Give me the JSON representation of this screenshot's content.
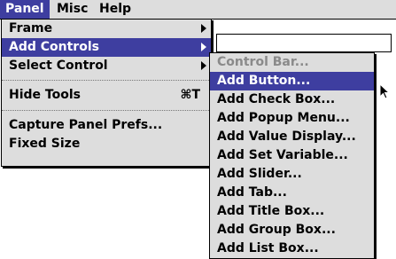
{
  "menubar": {
    "items": [
      {
        "label": "Panel"
      },
      {
        "label": "Misc"
      },
      {
        "label": "Help"
      }
    ]
  },
  "panel_menu": {
    "items": [
      {
        "label": "Frame",
        "submenu": true
      },
      {
        "label": "Add Controls",
        "submenu": true,
        "highlighted": true
      },
      {
        "label": "Select Control",
        "submenu": true
      },
      {
        "label": "Hide Tools",
        "shortcut": "⌘T"
      },
      {
        "label": "Capture Panel Prefs..."
      },
      {
        "label": "Fixed Size"
      }
    ]
  },
  "add_controls_submenu": {
    "items": [
      {
        "label": "Control Bar...",
        "disabled": true
      },
      {
        "label": "Add Button...",
        "highlighted": true
      },
      {
        "label": "Add Check Box..."
      },
      {
        "label": "Add Popup Menu..."
      },
      {
        "label": "Add Value Display..."
      },
      {
        "label": "Add Set Variable..."
      },
      {
        "label": "Add Slider..."
      },
      {
        "label": "Add Tab..."
      },
      {
        "label": "Add Title Box..."
      },
      {
        "label": "Add Group Box..."
      },
      {
        "label": "Add List Box..."
      }
    ]
  },
  "colors": {
    "highlight": "#3e3ea0",
    "menu_bg": "#dddddd",
    "disabled": "#8a8a8a"
  },
  "icons": {
    "submenu_arrow": "triangle-right",
    "cursor": "arrow-pointer"
  }
}
